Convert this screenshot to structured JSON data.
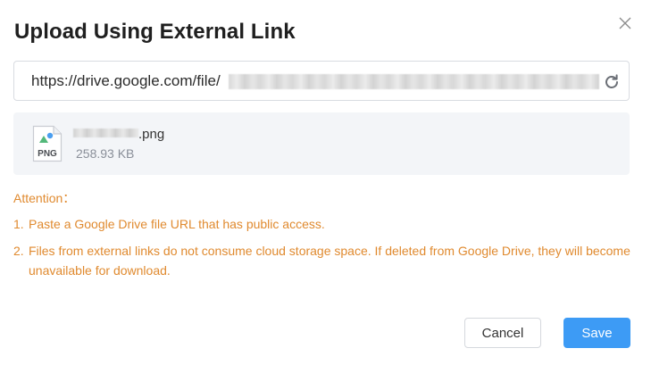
{
  "dialog": {
    "title": "Upload Using External Link",
    "close_icon": "close-icon"
  },
  "url_field": {
    "value_visible": "https://drive.google.com/file/",
    "refresh_icon": "refresh-icon"
  },
  "file": {
    "icon_label": "PNG",
    "name_suffix": ".png",
    "size": "258.93 KB"
  },
  "attention": {
    "label": "Attention：",
    "notes": [
      {
        "num": "1.",
        "text": "Paste a Google Drive file URL that has public access."
      },
      {
        "num": "2.",
        "text": "Files from external links do not consume cloud storage space. If deleted from Google Drive, they will become unavailable for download."
      }
    ]
  },
  "actions": {
    "cancel_label": "Cancel",
    "save_label": "Save"
  },
  "colors": {
    "accent": "#3d9bf5",
    "warning_text": "#e08a2f",
    "card_bg": "#f3f5f8"
  }
}
